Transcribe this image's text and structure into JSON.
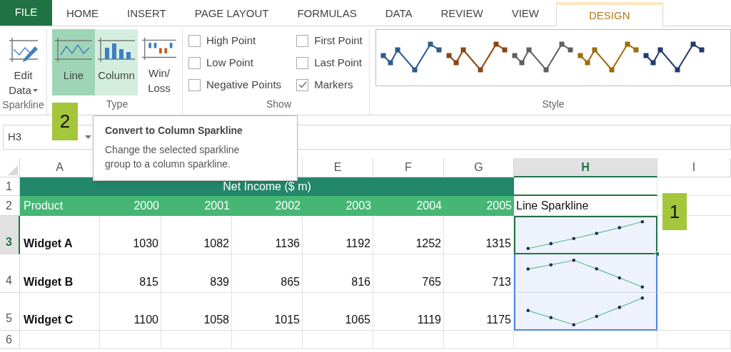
{
  "tabs": [
    {
      "label": "FILE",
      "kind": "file",
      "selected": false
    },
    {
      "label": "HOME",
      "kind": "tab",
      "selected": false
    },
    {
      "label": "INSERT",
      "kind": "tab",
      "selected": false
    },
    {
      "label": "PAGE LAYOUT",
      "kind": "tab",
      "selected": false
    },
    {
      "label": "FORMULAS",
      "kind": "tab",
      "selected": false
    },
    {
      "label": "DATA",
      "kind": "tab",
      "selected": false
    },
    {
      "label": "REVIEW",
      "kind": "tab",
      "selected": false
    },
    {
      "label": "VIEW",
      "kind": "tab",
      "selected": false
    },
    {
      "label": "DESIGN",
      "kind": "tab",
      "selected": true
    }
  ],
  "sparkline_group": {
    "label": "Sparkline",
    "edit_data": [
      "Edit",
      "Data"
    ]
  },
  "type_group": {
    "label": "Type",
    "callout": "2",
    "buttons": [
      {
        "label": [
          "Line"
        ],
        "kind": "line",
        "selected": true,
        "hovered": false
      },
      {
        "label": [
          "Column"
        ],
        "kind": "column",
        "selected": false,
        "hovered": true
      },
      {
        "label": [
          "Win/",
          "Loss"
        ],
        "kind": "winloss",
        "selected": false,
        "hovered": false
      }
    ]
  },
  "show_group": {
    "label": "Show",
    "options": [
      {
        "label": "High Point",
        "checked": false
      },
      {
        "label": "Low Point",
        "checked": false
      },
      {
        "label": "Negative Points",
        "checked": false
      },
      {
        "label": "First Point",
        "checked": false
      },
      {
        "label": "Last Point",
        "checked": false
      },
      {
        "label": "Markers",
        "checked": true
      }
    ]
  },
  "style_group": {
    "label": "Style",
    "styles": [
      {
        "color": "#2f5c8c"
      },
      {
        "color": "#8b4513"
      },
      {
        "color": "#606060"
      },
      {
        "color": "#9a6d0e"
      },
      {
        "color": "#223a6e"
      }
    ]
  },
  "name_box": "H3",
  "tooltip": {
    "title": "Convert to Column Sparkline",
    "text": "Change the selected sparkline group to a column sparkline."
  },
  "sheet": {
    "columns": [
      {
        "label": "A",
        "selected": false
      },
      {
        "label": "E",
        "selected": false
      },
      {
        "label": "F",
        "selected": false
      },
      {
        "label": "G",
        "selected": false
      },
      {
        "label": "H",
        "selected": true
      },
      {
        "label": "I",
        "selected": false
      }
    ],
    "title_row": {
      "number": "1",
      "title": "Net Income ($ m)"
    },
    "header_row": {
      "number": "2",
      "cells": [
        "Product",
        "2000",
        "2001",
        "2002",
        "2003",
        "2004",
        "2005"
      ],
      "sparkline_label": "Line Sparkline"
    },
    "data_rows": [
      {
        "number": "3",
        "selected": true,
        "cells": [
          "Widget A",
          "1030",
          "1082",
          "1136",
          "1192",
          "1252",
          "1315"
        ]
      },
      {
        "number": "4",
        "selected": false,
        "cells": [
          "Widget B",
          "815",
          "839",
          "865",
          "816",
          "765",
          "713"
        ]
      },
      {
        "number": "5",
        "selected": false,
        "cells": [
          "Widget C",
          "1100",
          "1058",
          "1015",
          "1065",
          "1119",
          "1175"
        ]
      }
    ],
    "empty_row": {
      "number": "6"
    },
    "callout": "1"
  }
}
